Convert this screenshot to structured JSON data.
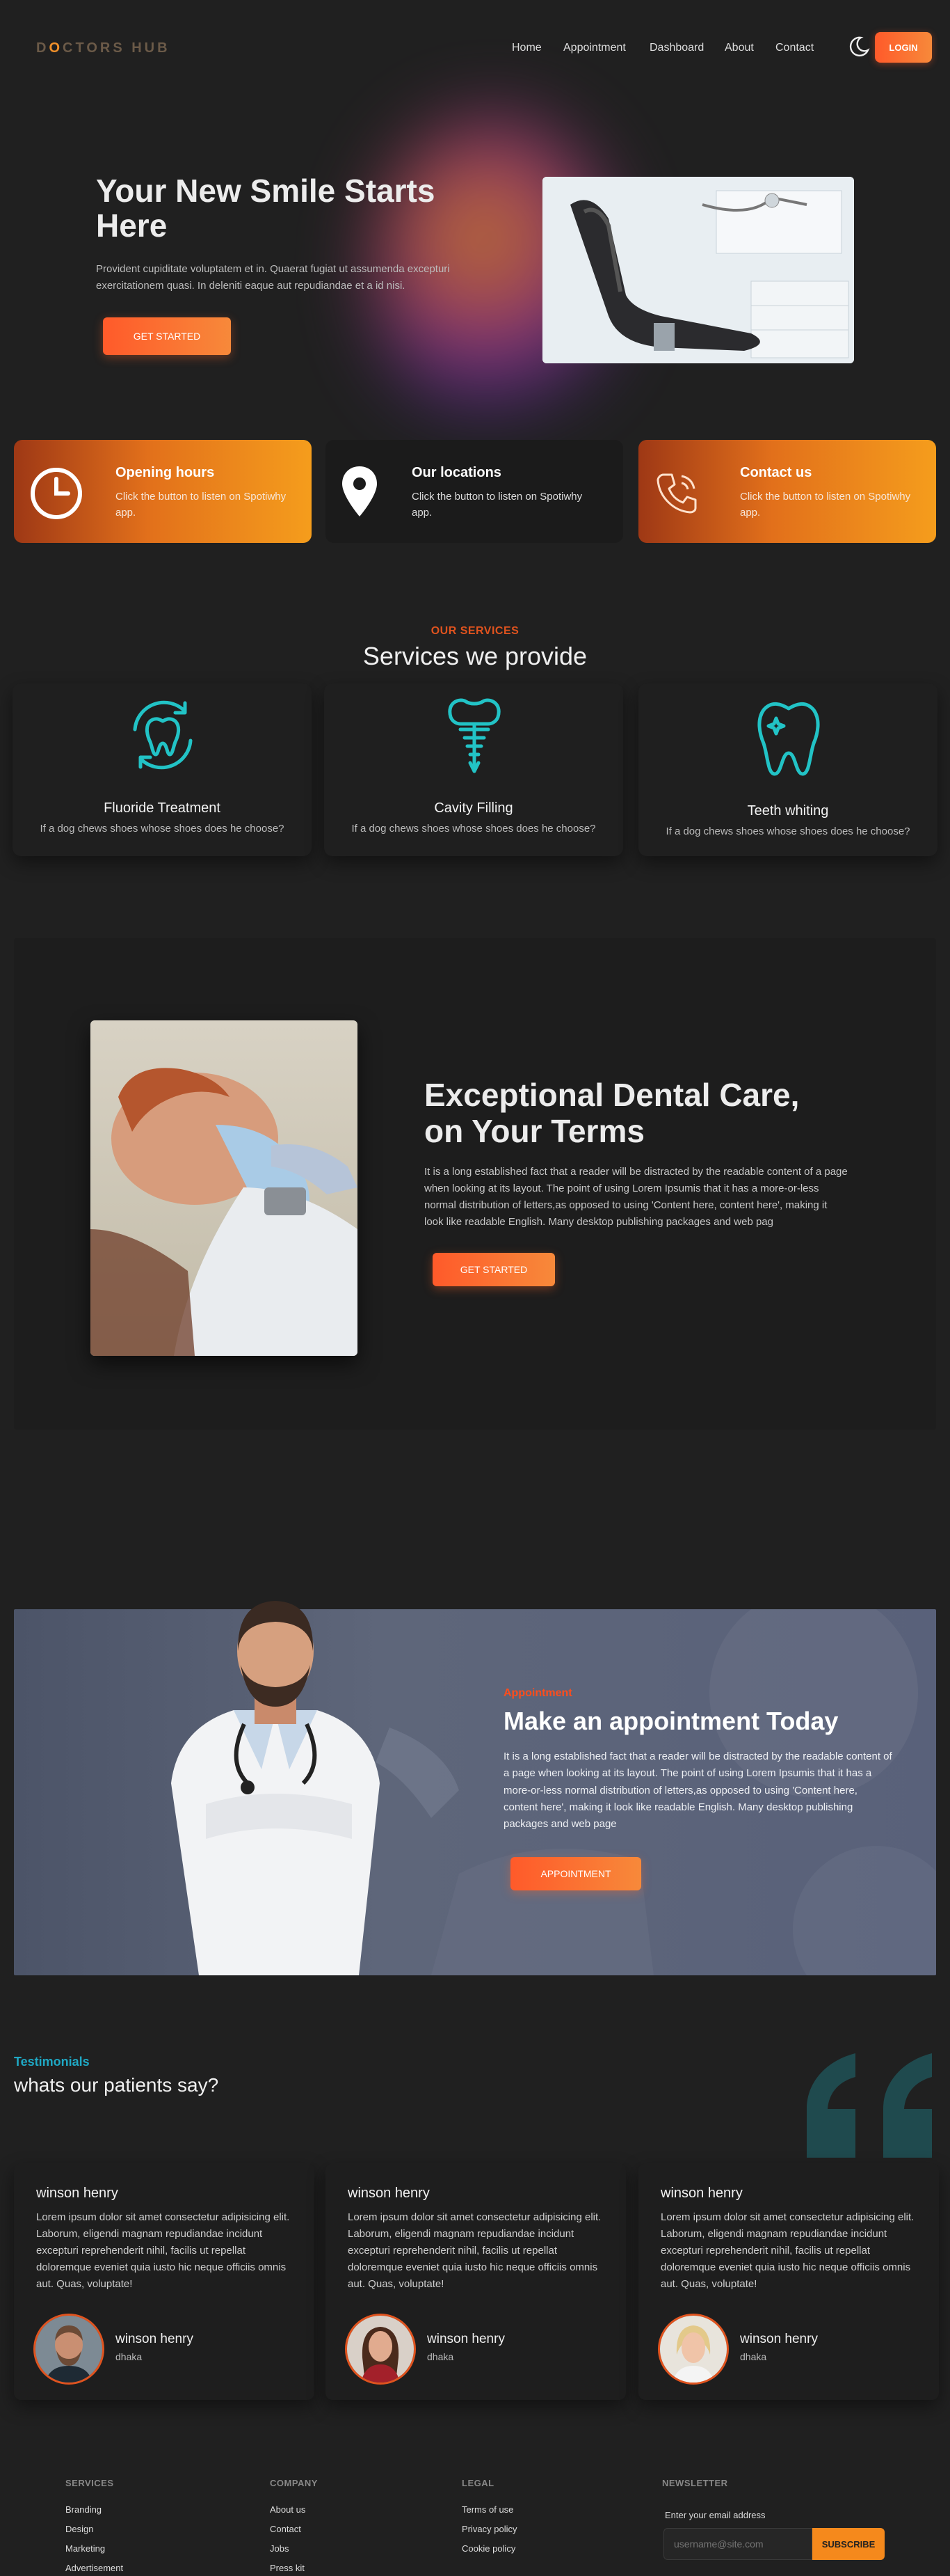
{
  "nav": {
    "logo_pre": "D",
    "logo_o": "O",
    "logo_post": "CTORS HUB",
    "links": [
      "Home",
      "Appointment",
      "Dashboard",
      "About",
      "Contact"
    ],
    "login": "LOGIN"
  },
  "hero": {
    "title": "Your New Smile Starts Here",
    "text": "Provident cupiditate voluptatem et in. Quaerat fugiat ut assumenda excepturi exercitationem quasi. In deleniti eaque aut repudiandae et a id nisi.",
    "button": "GET STARTED"
  },
  "info_cards": [
    {
      "title": "Opening hours",
      "text": "Click the button to listen on Spotiwhy app.",
      "icon": "clock-icon"
    },
    {
      "title": "Our locations",
      "text": "Click the button to listen on Spotiwhy app.",
      "icon": "map-pin-icon"
    },
    {
      "title": "Contact us",
      "text": "Click the button to listen on Spotiwhy app.",
      "icon": "phone-icon"
    }
  ],
  "services": {
    "kicker": "OUR SERVICES",
    "title": "Services we provide",
    "items": [
      {
        "name": "Fluoride Treatment",
        "desc": "If a dog chews shoes whose shoes does he choose?",
        "icon": "tooth-refresh-icon"
      },
      {
        "name": "Cavity Filling",
        "desc": "If a dog chews shoes whose shoes does he choose?",
        "icon": "dental-implant-icon"
      },
      {
        "name": "Teeth whiting",
        "desc": "If a dog chews shoes whose shoes does he choose?",
        "icon": "sparkle-tooth-icon"
      }
    ]
  },
  "feature": {
    "title": "Exceptional Dental Care, on Your Terms",
    "text": "It is a long established fact that a reader will be distracted by the readable content of a page when looking at its layout. The point of using Lorem Ipsumis that it has a more-or-less normal distribution of letters,as opposed to using 'Content here, content here', making it look like readable English. Many desktop publishing packages and web pag",
    "button": "GET STARTED"
  },
  "appointment": {
    "kicker": "Appointment",
    "title": "Make an appointment Today",
    "text": "It is a long established fact that a reader will be distracted by the readable content of a page when looking at its layout. The point of using Lorem Ipsumis that it has a more-or-less normal distribution of letters,as opposed to using 'Content here, content here', making it look like readable English. Many desktop publishing packages and web page",
    "button": "APPOINTMENT"
  },
  "testimonials": {
    "kicker": "Testimonials",
    "title": "whats our patients say?",
    "items": [
      {
        "heading": "winson henry",
        "body": "Lorem ipsum dolor sit amet consectetur adipisicing elit. Laborum, eligendi magnam repudiandae incidunt excepturi reprehenderit nihil, facilis ut repellat doloremque eveniet quia iusto hic neque officiis omnis aut. Quas, voluptate!",
        "name": "winson henry",
        "location": "dhaka"
      },
      {
        "heading": "winson henry",
        "body": "Lorem ipsum dolor sit amet consectetur adipisicing elit. Laborum, eligendi magnam repudiandae incidunt excepturi reprehenderit nihil, facilis ut repellat doloremque eveniet quia iusto hic neque officiis omnis aut. Quas, voluptate!",
        "name": "winson henry",
        "location": "dhaka"
      },
      {
        "heading": "winson henry",
        "body": "Lorem ipsum dolor sit amet consectetur adipisicing elit. Laborum, eligendi magnam repudiandae incidunt excepturi reprehenderit nihil, facilis ut repellat doloremque eveniet quia iusto hic neque officiis omnis aut. Quas, voluptate!",
        "name": "winson henry",
        "location": "dhaka"
      }
    ]
  },
  "footer": {
    "services": {
      "heading": "SERVICES",
      "links": [
        "Branding",
        "Design",
        "Marketing",
        "Advertisement"
      ]
    },
    "company": {
      "heading": "COMPANY",
      "links": [
        "About us",
        "Contact",
        "Jobs",
        "Press kit"
      ]
    },
    "legal": {
      "heading": "LEGAL",
      "links": [
        "Terms of use",
        "Privacy policy",
        "Cookie policy"
      ]
    },
    "newsletter": {
      "heading": "NEWSLETTER",
      "label": "Enter your email address",
      "placeholder": "username@site.com",
      "button": "SUBSCRIBE"
    }
  },
  "colors": {
    "accent": "#ff5a2a",
    "orange": "#f59d1c",
    "teal": "#20c4c8",
    "background": "#202020"
  }
}
